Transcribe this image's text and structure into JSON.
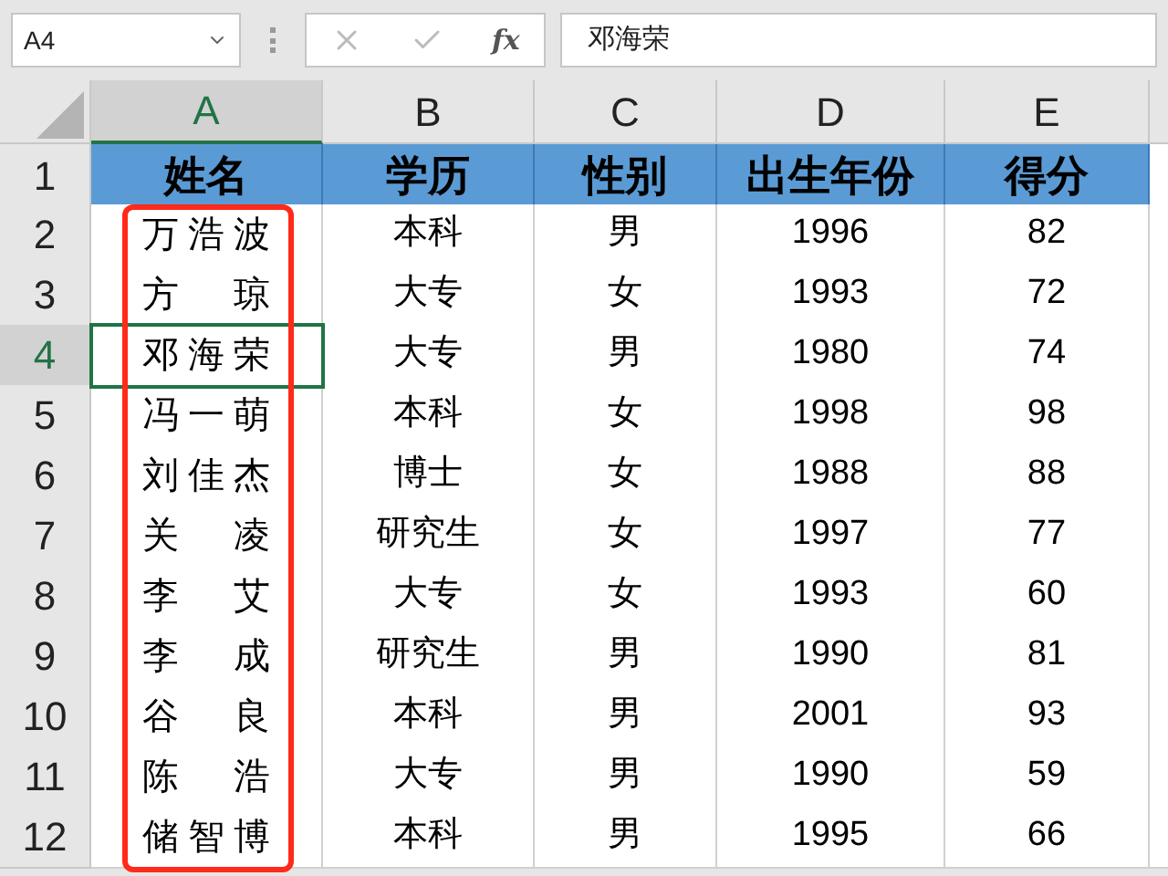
{
  "name_box": "A4",
  "formula_bar": {
    "fx": "fx",
    "value": "邓海荣"
  },
  "columns": [
    {
      "label": "A",
      "selected": true
    },
    {
      "label": "B",
      "selected": false
    },
    {
      "label": "C",
      "selected": false
    },
    {
      "label": "D",
      "selected": false
    },
    {
      "label": "E",
      "selected": false
    }
  ],
  "header_row": {
    "number": "1",
    "cells": [
      "姓名",
      "学历",
      "性别",
      "出生年份",
      "得分"
    ]
  },
  "rows": [
    {
      "number": "2",
      "selected": false,
      "cells": [
        "万浩波",
        "本科",
        "男",
        "1996",
        "82"
      ]
    },
    {
      "number": "3",
      "selected": false,
      "cells": [
        "方琼",
        "大专",
        "女",
        "1993",
        "72"
      ]
    },
    {
      "number": "4",
      "selected": true,
      "cells": [
        "邓海荣",
        "大专",
        "男",
        "1980",
        "74"
      ]
    },
    {
      "number": "5",
      "selected": false,
      "cells": [
        "冯一萌",
        "本科",
        "女",
        "1998",
        "98"
      ]
    },
    {
      "number": "6",
      "selected": false,
      "cells": [
        "刘佳杰",
        "博士",
        "女",
        "1988",
        "88"
      ]
    },
    {
      "number": "7",
      "selected": false,
      "cells": [
        "关凌",
        "研究生",
        "女",
        "1997",
        "77"
      ]
    },
    {
      "number": "8",
      "selected": false,
      "cells": [
        "李艾",
        "大专",
        "女",
        "1993",
        "60"
      ]
    },
    {
      "number": "9",
      "selected": false,
      "cells": [
        "李成",
        "研究生",
        "男",
        "1990",
        "81"
      ]
    },
    {
      "number": "10",
      "selected": false,
      "cells": [
        "谷良",
        "本科",
        "男",
        "2001",
        "93"
      ]
    },
    {
      "number": "11",
      "selected": false,
      "cells": [
        "陈浩",
        "大专",
        "男",
        "1990",
        "59"
      ]
    },
    {
      "number": "12",
      "selected": false,
      "cells": [
        "储智博",
        "本科",
        "男",
        "1995",
        "66"
      ]
    }
  ]
}
